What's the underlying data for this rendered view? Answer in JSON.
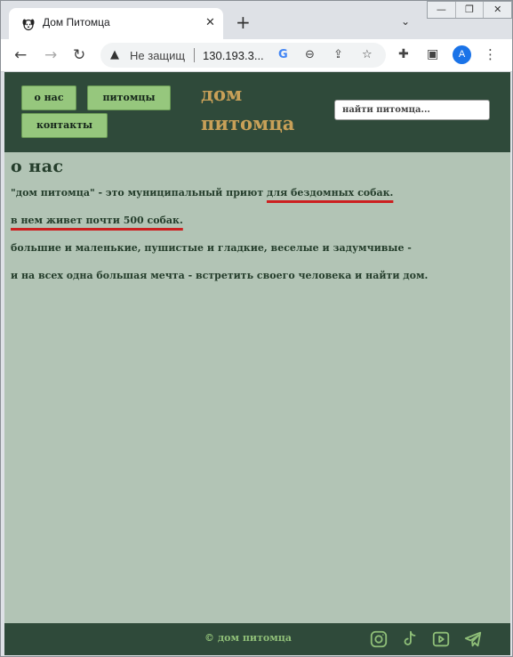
{
  "browser": {
    "tab_title": "Дом Питомца",
    "tab_close": "✕",
    "new_tab": "+",
    "tab_search": "⌄",
    "window_buttons": {
      "minimize": "—",
      "maximize": "❐",
      "close": "✕"
    },
    "nav": {
      "back": "←",
      "forward": "→",
      "reload": "↻"
    },
    "security_warning": "▲",
    "security_text": "Не защищ",
    "url": "130.193.3...",
    "profile_initial": "A",
    "menu": "⋮"
  },
  "header": {
    "nav_buttons": [
      "о нас",
      "питомцы",
      "контакты"
    ],
    "site_title": "дом питомца",
    "search_placeholder": "найти питомца..."
  },
  "content": {
    "heading": "о нас",
    "p1_plain": "\"дом питомца\" - это муниципальный приют ",
    "p1_underlined": "для бездомных собак.",
    "p2_underlined": "в нем живет почти 500 собак.",
    "p3": "большие и маленькие, пушистые и гладкие, веселые и задумчивые -",
    "p4": "и на всех одна большая мечта - встретить своего человека и найти дом."
  },
  "footer": {
    "copyright": "© дом питомца",
    "social_icons": [
      "instagram-icon",
      "tiktok-icon",
      "youtube-icon",
      "telegram-icon"
    ]
  },
  "colors": {
    "header_bg": "#2f4a3a",
    "page_bg": "#b2c4b5",
    "nav_button_bg": "#96c77d",
    "title_color": "#c8a058",
    "text_color": "#253e2c",
    "underline_color": "#cc2020",
    "footer_text": "#8fbf78"
  }
}
